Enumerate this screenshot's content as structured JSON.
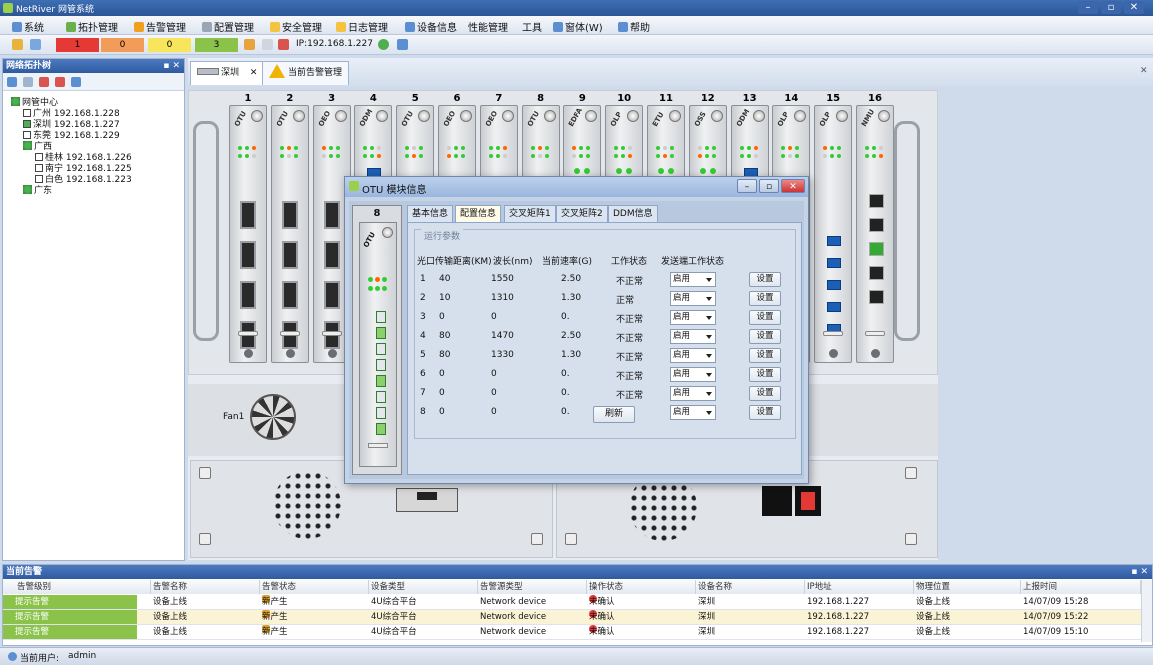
{
  "window": {
    "title": "NetRiver 网管系统",
    "min": "–",
    "max": "▫",
    "close": "✕"
  },
  "menu": [
    {
      "label": "系统",
      "icon": "system-icon",
      "color": "#5b8fd1"
    },
    {
      "label": "拓扑管理",
      "icon": "topology-icon",
      "color": "#6ab04c"
    },
    {
      "label": "告警管理",
      "icon": "alarm-icon",
      "color": "#f0a020"
    },
    {
      "label": "配置管理",
      "icon": "config-icon",
      "color": "#9aa6b6"
    },
    {
      "label": "安全管理",
      "icon": "security-icon",
      "color": "#f5c342"
    },
    {
      "label": "日志管理",
      "icon": "log-icon",
      "color": "#f5c342"
    },
    {
      "label": "设备信息",
      "icon": "device-info-icon",
      "color": "#5b8fd1"
    },
    {
      "label": "性能管理",
      "icon": "",
      "color": ""
    },
    {
      "label": "工具",
      "icon": "",
      "color": ""
    },
    {
      "label": "窗体(W)",
      "icon": "window-icon",
      "color": "#5b8fd1"
    },
    {
      "label": "帮助",
      "icon": "help-icon",
      "color": "#5b8fd1"
    }
  ],
  "toolbar": {
    "counters": [
      {
        "value": "1",
        "color": "#e53935"
      },
      {
        "value": "0",
        "color": "#f39c5a"
      },
      {
        "value": "0",
        "color": "#f7e55b"
      },
      {
        "value": "3",
        "color": "#8bc34a"
      }
    ],
    "ip_label": "IP:192.168.1.227"
  },
  "left_panel": {
    "title": "网络拓扑树",
    "tree": [
      {
        "label": "网管中心",
        "type": "group"
      },
      {
        "label": "广州 192.168.1.228",
        "type": "node"
      },
      {
        "label": "深圳 192.168.1.227",
        "type": "node-active"
      },
      {
        "label": "东莞 192.168.1.229",
        "type": "node"
      },
      {
        "label": "广西",
        "type": "group"
      },
      {
        "label": "桂林 192.168.1.226",
        "type": "node"
      },
      {
        "label": "南宁 192.168.1.225",
        "type": "node"
      },
      {
        "label": "白色 192.168.1.223",
        "type": "node"
      },
      {
        "label": "广东",
        "type": "group"
      }
    ]
  },
  "tabs": [
    {
      "label": "深圳",
      "close": "✕"
    },
    {
      "label": "当前告警管理"
    }
  ],
  "rack": {
    "slots": [
      "1",
      "2",
      "3",
      "4",
      "5",
      "6",
      "7",
      "8",
      "9",
      "10",
      "11",
      "12",
      "13",
      "14",
      "15",
      "16"
    ],
    "cards": [
      "OTU",
      "OTU",
      "OEO",
      "ODM",
      "OTU",
      "OEO",
      "OEO",
      "OTU",
      "EDFA",
      "OLP",
      "ETU",
      "OSS",
      "ODM",
      "OLP",
      "OLP",
      "NMU"
    ],
    "fan_label": "Fan1"
  },
  "dialog": {
    "title": "OTU 模块信息",
    "slot_number": "8",
    "card_label": "OTU",
    "tabs": [
      "基本信息",
      "配置信息",
      "交叉矩阵1",
      "交叉矩阵2",
      "DDM信息"
    ],
    "active_tab": 1,
    "section_legend": "运行参数",
    "columns": [
      "光口",
      "传输距离(KM)",
      "波长(nm)",
      "当前速率(G)",
      "工作状态",
      "发送端工作状态"
    ],
    "rows": [
      {
        "port": "1",
        "distance": "40",
        "wavelength": "1550",
        "rate": "2.50",
        "status": "不正常",
        "tx": "启用",
        "button": "设置"
      },
      {
        "port": "2",
        "distance": "10",
        "wavelength": "1310",
        "rate": "1.30",
        "status": "正常",
        "tx": "启用",
        "button": "设置"
      },
      {
        "port": "3",
        "distance": "0",
        "wavelength": "0",
        "rate": "0.",
        "status": "不正常",
        "tx": "启用",
        "button": "设置"
      },
      {
        "port": "4",
        "distance": "80",
        "wavelength": "1470",
        "rate": "2.50",
        "status": "不正常",
        "tx": "启用",
        "button": "设置"
      },
      {
        "port": "5",
        "distance": "80",
        "wavelength": "1330",
        "rate": "1.30",
        "status": "不正常",
        "tx": "启用",
        "button": "设置"
      },
      {
        "port": "6",
        "distance": "0",
        "wavelength": "0",
        "rate": "0.",
        "status": "不正常",
        "tx": "启用",
        "button": "设置"
      },
      {
        "port": "7",
        "distance": "0",
        "wavelength": "0",
        "rate": "0.",
        "status": "不正常",
        "tx": "启用",
        "button": "设置"
      },
      {
        "port": "8",
        "distance": "0",
        "wavelength": "0",
        "rate": "0.",
        "status": "正常",
        "tx": "启用",
        "button": "设置"
      }
    ],
    "refresh_label": "刷新"
  },
  "alarm_panel": {
    "title": "当前告警",
    "pin": "▪ ✕",
    "columns": [
      "告警级别",
      "告警名称",
      "告警状态",
      "设备类型",
      "告警源类型",
      "操作状态",
      "设备名称",
      "IP地址",
      "物理位置",
      "上报时间"
    ],
    "rows": [
      {
        "level": "提示告警",
        "name": "设备上线",
        "state": "新产生",
        "devtype": "4U综合平台",
        "srctype": "Network device",
        "op": "未确认",
        "devname": "深圳",
        "ip": "192.168.1.227",
        "loc": "设备上线",
        "time": "14/07/09 15:28"
      },
      {
        "level": "提示告警",
        "name": "设备上线",
        "state": "新产生",
        "devtype": "4U综合平台",
        "srctype": "Network device",
        "op": "未确认",
        "devname": "深圳",
        "ip": "192.168.1.227",
        "loc": "设备上线",
        "time": "14/07/09 15:22"
      },
      {
        "level": "提示告警",
        "name": "设备上线",
        "state": "新产生",
        "devtype": "4U综合平台",
        "srctype": "Network device",
        "op": "未确认",
        "devname": "深圳",
        "ip": "192.168.1.227",
        "loc": "设备上线",
        "time": "14/07/09 15:10"
      }
    ]
  },
  "status": {
    "user_label": "当前用户:",
    "user": "admin"
  }
}
